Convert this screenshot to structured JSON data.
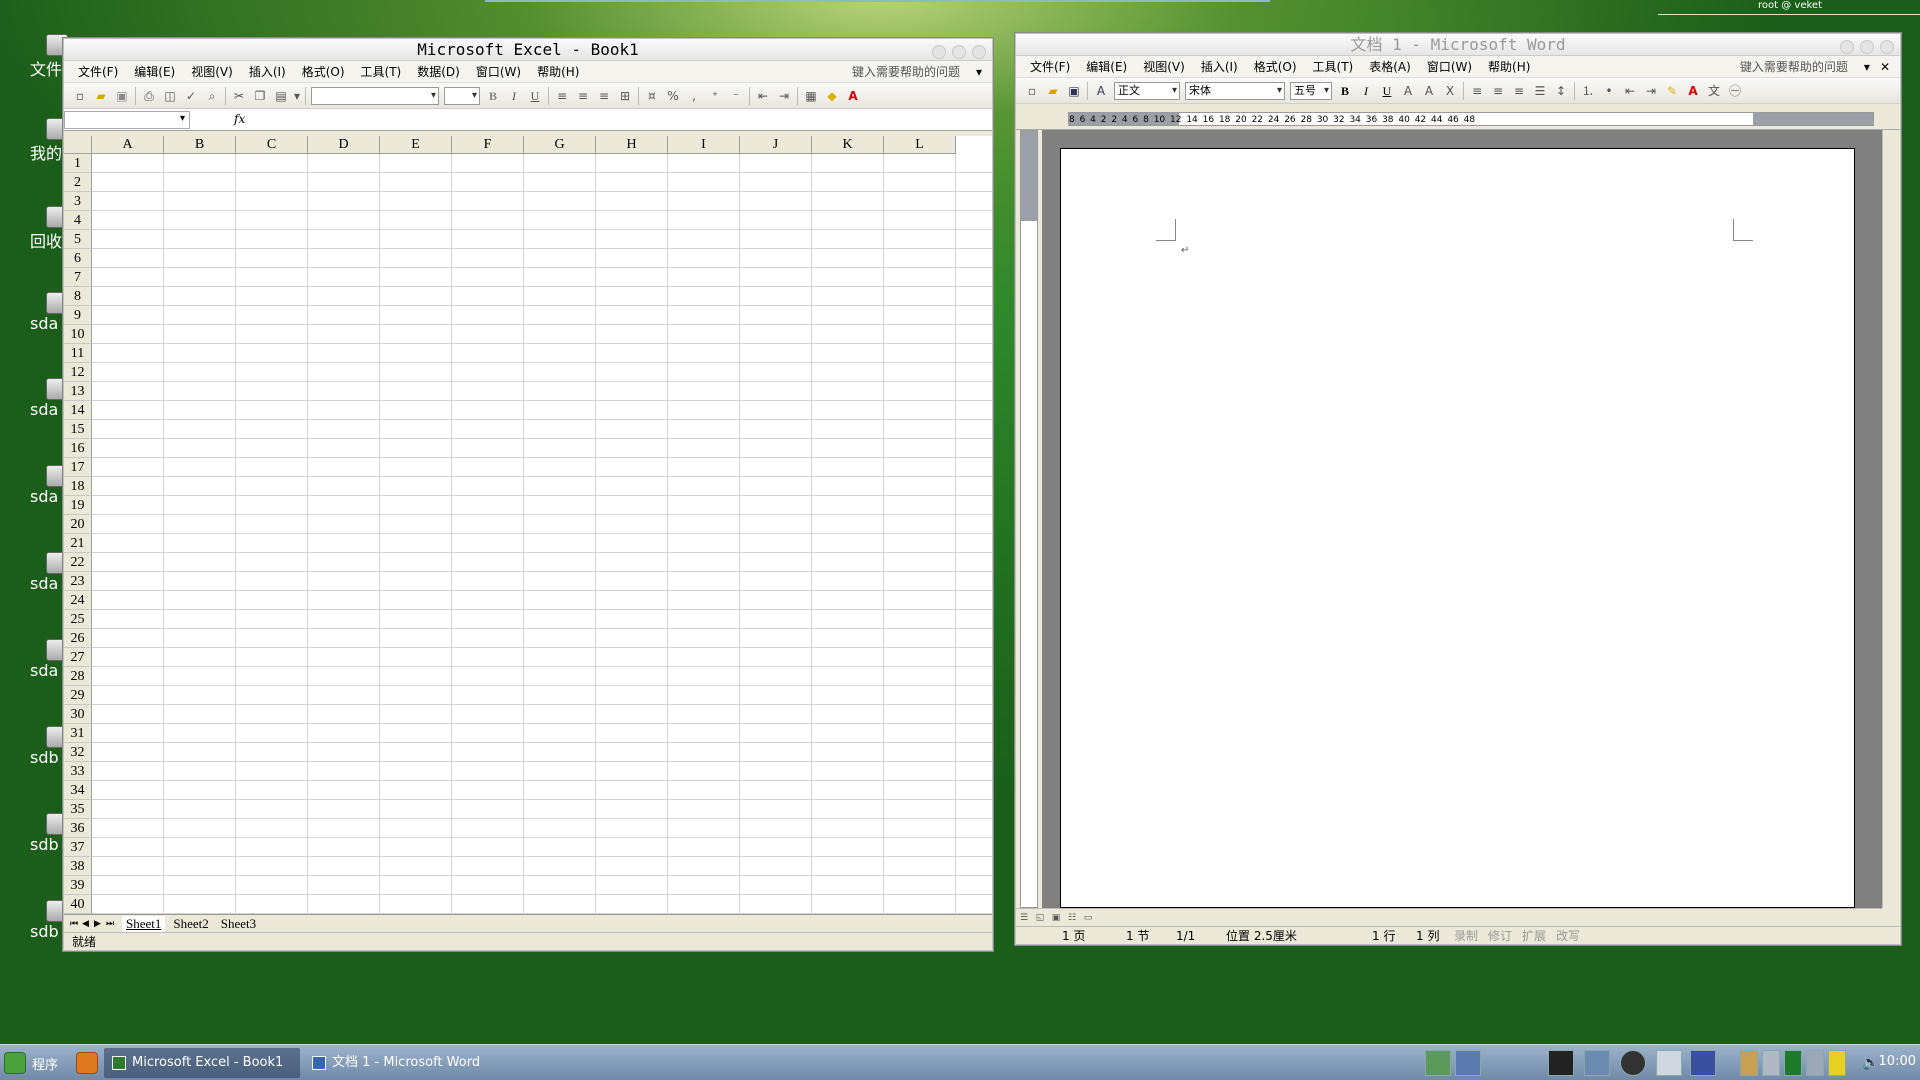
{
  "desktop": {
    "user_label": "root @ veket",
    "icons": [
      {
        "label": "文件"
      },
      {
        "label": "我的"
      },
      {
        "label": "回收"
      },
      {
        "label": "sda"
      },
      {
        "label": "sda"
      },
      {
        "label": "sda"
      },
      {
        "label": "sda"
      },
      {
        "label": "sda"
      },
      {
        "label": "sdb"
      },
      {
        "label": "sdb"
      },
      {
        "label": "sdb"
      }
    ]
  },
  "excel": {
    "title": "Microsoft Excel - Book1",
    "menu": [
      "文件(F)",
      "编辑(E)",
      "视图(V)",
      "插入(I)",
      "格式(O)",
      "工具(T)",
      "数据(D)",
      "窗口(W)",
      "帮助(H)"
    ],
    "help_placeholder": "键入需要帮助的问题",
    "fx_label": "fx",
    "columns": [
      "A",
      "B",
      "C",
      "D",
      "E",
      "F",
      "G",
      "H",
      "I",
      "J",
      "K",
      "L"
    ],
    "rows": [
      "1",
      "2",
      "3",
      "4",
      "5",
      "6",
      "7",
      "8",
      "9",
      "10",
      "11",
      "12",
      "13",
      "14",
      "15",
      "16",
      "17",
      "18",
      "19",
      "20",
      "21",
      "22",
      "23",
      "24",
      "25",
      "26",
      "27",
      "28",
      "29",
      "30",
      "31",
      "32",
      "33",
      "34",
      "35",
      "36",
      "37",
      "38",
      "39",
      "40"
    ],
    "sheets": [
      "Sheet1",
      "Sheet2",
      "Sheet3"
    ],
    "active_sheet": "Sheet1",
    "status": "就绪"
  },
  "word": {
    "title": "文档 1 - Microsoft Word",
    "menu": [
      "文件(F)",
      "编辑(E)",
      "视图(V)",
      "插入(I)",
      "格式(O)",
      "工具(T)",
      "表格(A)",
      "窗口(W)",
      "帮助(H)"
    ],
    "help_placeholder": "键入需要帮助的问题",
    "style_value": "正文",
    "font_value": "宋体",
    "size_value": "五号",
    "ruler_marks": "8 6 4 2 2 4 6 8 10 12 14 16 18 20 22 24 26 28 30 32 34 36 38 40 42 44 46 48",
    "paragraph_mark": "↵",
    "status": {
      "page": "1 页",
      "section": "1 节",
      "pages": "1/1",
      "position": "位置 2.5厘米",
      "line": "1 行",
      "column": "1 列",
      "rec": "录制",
      "trk": "修订",
      "ext": "扩展",
      "ovr": "改写"
    }
  },
  "taskbar": {
    "start_label": "程序",
    "tasks": [
      {
        "label": "Microsoft Excel - Book1"
      },
      {
        "label": "文档 1 - Microsoft Word"
      }
    ],
    "clock": "10:00"
  }
}
